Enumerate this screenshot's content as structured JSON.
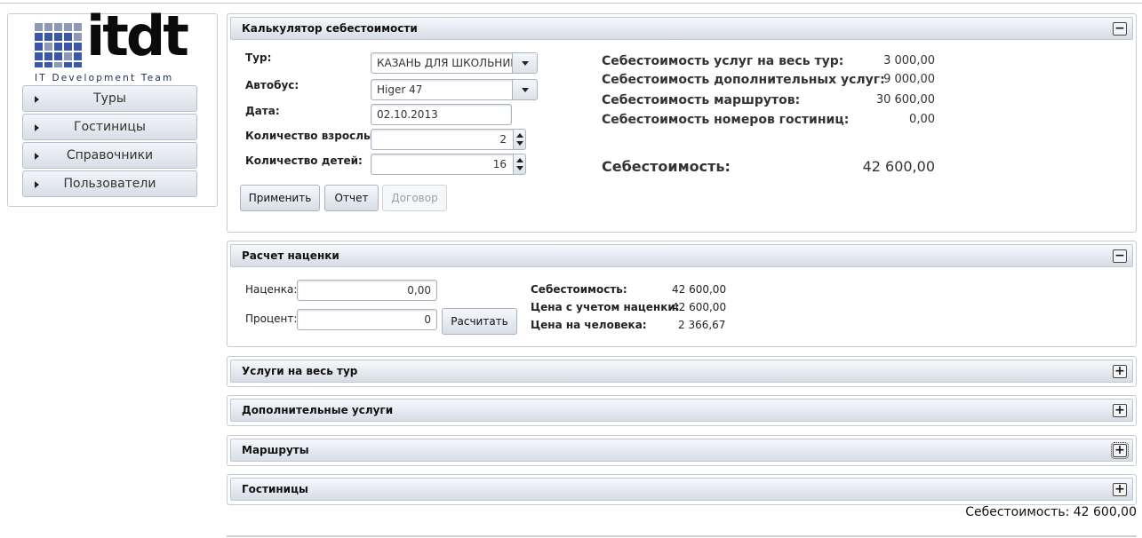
{
  "logo": {
    "word": "itdt",
    "tagline": "IT Development Team",
    "grid_colors": [
      "#3b57a8",
      "#8e9ab5",
      "#3b57a8",
      "#3b57a8"
    ]
  },
  "nav": {
    "items": [
      {
        "label": "Туры"
      },
      {
        "label": "Гостиницы"
      },
      {
        "label": "Справочники"
      },
      {
        "label": "Пользователи"
      }
    ]
  },
  "calc": {
    "title": "Калькулятор себестоимости",
    "toggle": "−",
    "tour_label": "Тур:",
    "tour_value": "КАЗАНЬ ДЛЯ ШКОЛЬНИКОВ",
    "bus_label": "Автобус:",
    "bus_value": "Higer 47",
    "date_label": "Дата:",
    "date_value": "02.10.2013",
    "adults_label": "Количество взрослых:",
    "adults_value": "2",
    "children_label": "Количество детей:",
    "children_value": "16",
    "apply_btn": "Применить",
    "report_btn": "Отчет",
    "contract_btn": "Договор",
    "summary": [
      {
        "label": "Себестоимость услуг на весь тур:",
        "value": "3 000,00"
      },
      {
        "label": "Себестоимость дополнительных услуг:",
        "value": "9 000,00"
      },
      {
        "label": "Себестоимость маршрутов:",
        "value": "30 600,00"
      },
      {
        "label": "Себестоимость номеров гостиниц:",
        "value": "0,00"
      }
    ],
    "total_label": "Себестоимость:",
    "total_value": "42 600,00"
  },
  "markup": {
    "title": "Расчет наценки",
    "toggle": "−",
    "markup_label": "Наценка:",
    "markup_value": "0,00",
    "percent_label": "Процент:",
    "percent_value": "0",
    "calc_btn": "Расчитать",
    "cost_label": "Себестоимость:",
    "cost_value": "42 600,00",
    "price_label": "Цена с учетом наценки:",
    "price_value": "42 600,00",
    "per_person_label": "Цена на человека:",
    "per_person_value": "2 366,67"
  },
  "sections": [
    {
      "title": "Услуги на весь тур",
      "toggle": "+"
    },
    {
      "title": "Дополнительные услуги",
      "toggle": "+"
    },
    {
      "title": "Маршруты",
      "toggle": "+"
    },
    {
      "title": "Гостиницы",
      "toggle": "+"
    }
  ],
  "footer_total": "Себестоимость: 42 600,00"
}
